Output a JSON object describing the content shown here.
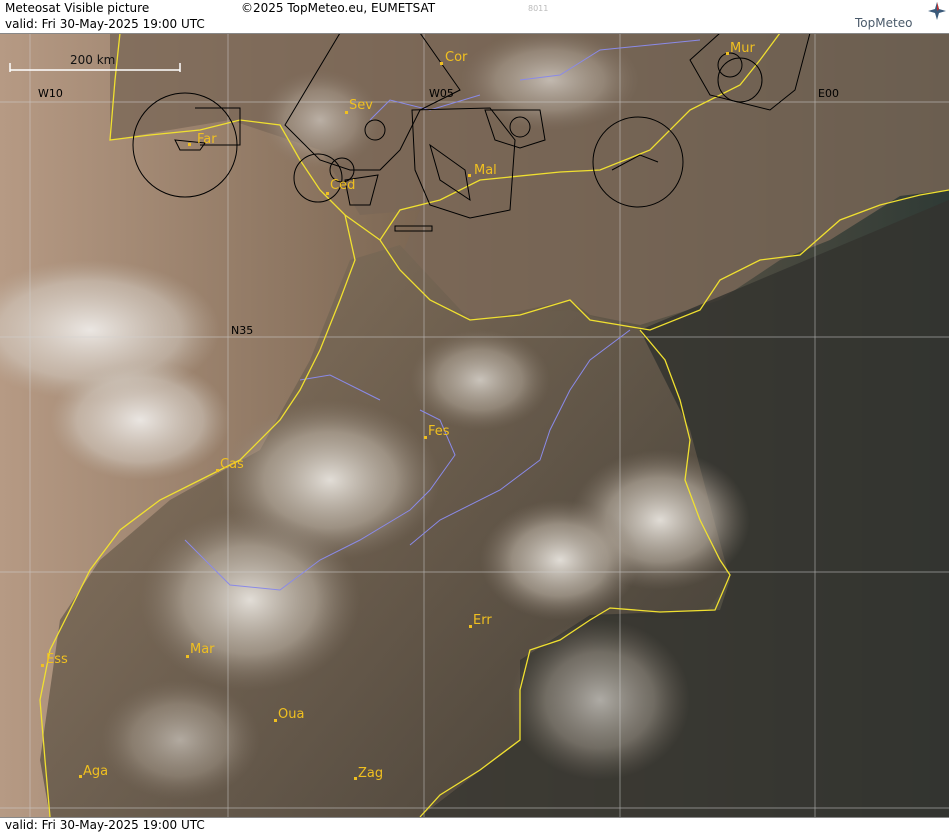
{
  "header": {
    "title": "Meteosat Visible picture",
    "valid": "valid:  Fri  30-May-2025  19:00 UTC",
    "copyright": "©2025 TopMeteo.eu, EUMETSAT",
    "code": "8011",
    "logo": "TopMeteo"
  },
  "footer": {
    "valid": "valid:  Fri  30-May-2025  19:00 UTC"
  },
  "scale": {
    "label": "200 km"
  },
  "grid": {
    "lon_w10": "W10",
    "lon_w05": "W05",
    "lon_e00": "E00",
    "lat_n35": "N35"
  },
  "cities": {
    "far": "Far",
    "sev": "Sev",
    "cor": "Cor",
    "mur": "Mur",
    "ced": "Ced",
    "mal": "Mal",
    "fes": "Fes",
    "cas": "Cas",
    "err": "Err",
    "mar": "Mar",
    "ess": "Ess",
    "oua": "Oua",
    "aga": "Aga",
    "zag": "Zag"
  },
  "colors": {
    "coast": "#f0e030",
    "city": "#f0c020",
    "rivers": "#8a8ae8",
    "airspace": "#000000",
    "grid": "#d0d0d0"
  }
}
